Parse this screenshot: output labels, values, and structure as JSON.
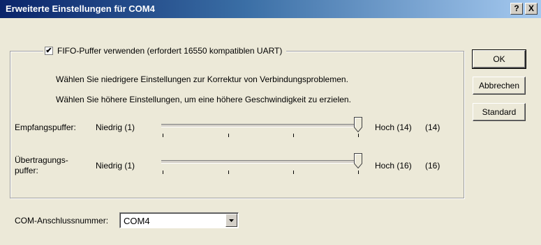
{
  "window": {
    "title": "Erweiterte Einstellungen für COM4",
    "help_label": "?",
    "close_label": "X"
  },
  "fifo": {
    "checked": true,
    "check_mark": "✔",
    "label": "FIFO-Puffer verwenden (erfordert 16550 kompatiblen UART)",
    "hint_low": "Wählen Sie niedrigere Einstellungen zur Korrektur von Verbindungsproblemen.",
    "hint_high": "Wählen Sie höhere Einstellungen, um eine höhere Geschwindigkeit zu erzielen."
  },
  "receive_buffer": {
    "label": "Empfangspuffer:",
    "min_label": "Niedrig (1)",
    "max_label": "Hoch (14)",
    "value_label": "(14)",
    "value": 14,
    "min": 1,
    "max": 14
  },
  "transmit_buffer": {
    "label_line1": "Übertragungs-",
    "label_line2": "puffer:",
    "min_label": "Niedrig (1)",
    "max_label": "Hoch (16)",
    "value_label": "(16)",
    "value": 16,
    "min": 1,
    "max": 16
  },
  "buttons": {
    "ok": "OK",
    "cancel": "Abbrechen",
    "default": "Standard"
  },
  "com_port": {
    "label": "COM-Anschlussnummer:",
    "selected": "COM4"
  }
}
